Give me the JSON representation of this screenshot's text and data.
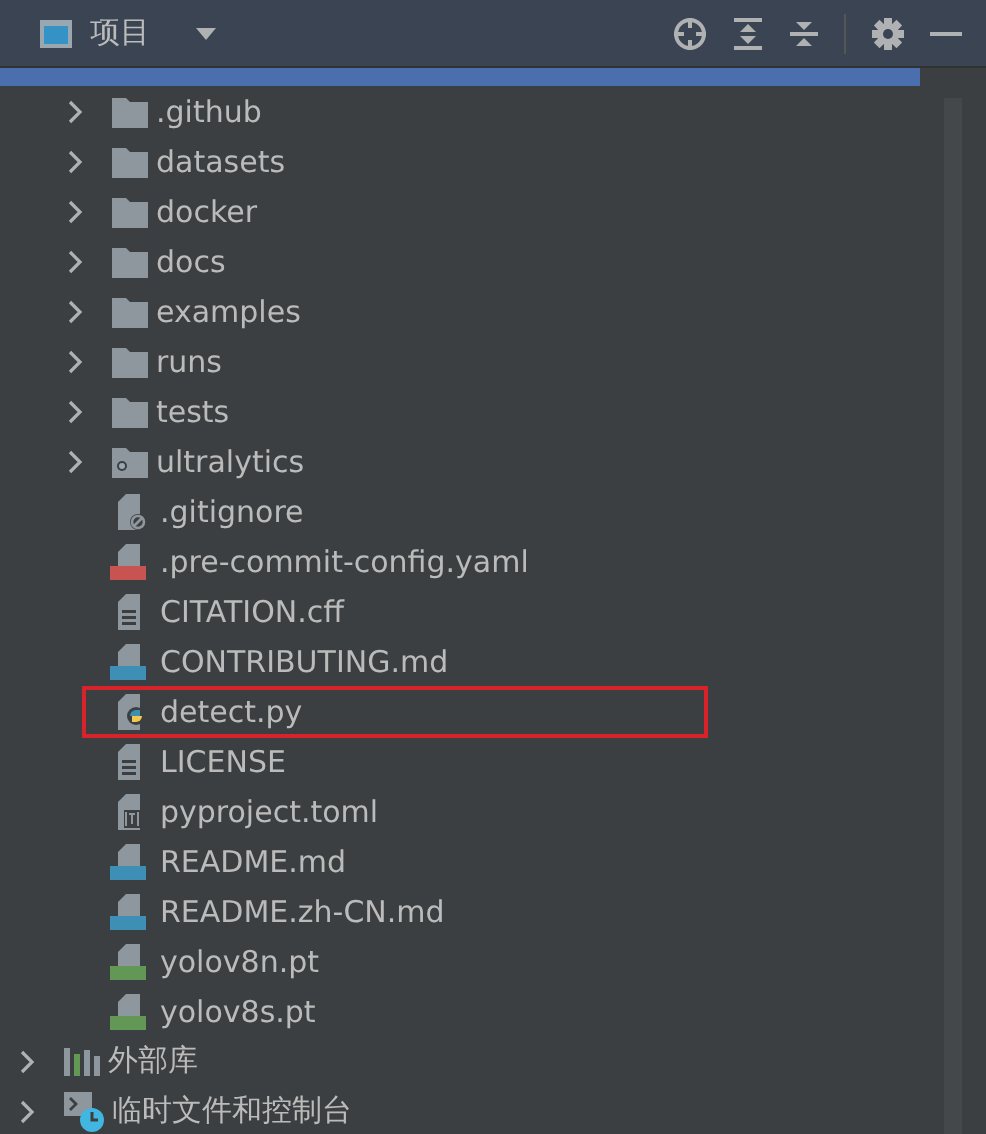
{
  "header": {
    "title": "项目"
  },
  "tree": [
    {
      "kind": "project",
      "selected": true,
      "children": [
        {
          "kind": "folder",
          "name": ".github",
          "expanded": false
        },
        {
          "kind": "folder",
          "name": "datasets",
          "expanded": false
        },
        {
          "kind": "folder",
          "name": "docker",
          "expanded": false
        },
        {
          "kind": "folder",
          "name": "docs",
          "expanded": false
        },
        {
          "kind": "folder",
          "name": "examples",
          "expanded": false
        },
        {
          "kind": "folder",
          "name": "runs",
          "expanded": false
        },
        {
          "kind": "folder",
          "name": "tests",
          "expanded": false
        },
        {
          "kind": "module",
          "name": "ultralytics",
          "expanded": false
        },
        {
          "kind": "ignore",
          "name": ".gitignore"
        },
        {
          "kind": "yml",
          "name": ".pre-commit-config.yaml"
        },
        {
          "kind": "text",
          "name": "CITATION.cff"
        },
        {
          "kind": "md",
          "name": "CONTRIBUTING.md"
        },
        {
          "kind": "python",
          "name": "detect.py",
          "highlighted": true
        },
        {
          "kind": "text",
          "name": "LICENSE"
        },
        {
          "kind": "toml",
          "name": "pyproject.toml"
        },
        {
          "kind": "md",
          "name": "README.md"
        },
        {
          "kind": "md",
          "name": "README.zh-CN.md"
        },
        {
          "kind": "binary",
          "name": "yolov8n.pt"
        },
        {
          "kind": "binary",
          "name": "yolov8s.pt"
        }
      ]
    },
    {
      "kind": "library",
      "name": "外部库",
      "expanded": false
    },
    {
      "kind": "scratch",
      "name": "临时文件和控制台",
      "expanded": false
    }
  ]
}
